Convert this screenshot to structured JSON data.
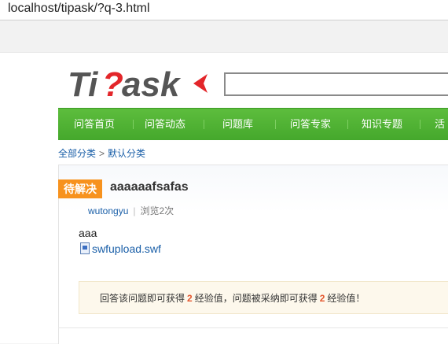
{
  "browser": {
    "url": "localhost/tipask/?q-3.html"
  },
  "logo": {
    "text": "Tipask"
  },
  "nav": {
    "items": [
      "问答首页",
      "问答动态",
      "问题库",
      "问答专家",
      "知识专题",
      "活"
    ]
  },
  "breadcrumb": {
    "root": "全部分类",
    "separator": ">",
    "current": "默认分类"
  },
  "question": {
    "status": "待解决",
    "title": "aaaaaafsafas",
    "author": "wutongyu",
    "views_label": "浏览2次",
    "body": "aaa",
    "attachment": "swfupload.swf"
  },
  "notice": {
    "part1": "回答该问题即可获得",
    "reward1": "2",
    "part2": "经验值，问题被采纳即可获得",
    "reward2": "2",
    "part3": "经验值！"
  },
  "colors": {
    "nav_green": "#4db332",
    "badge_orange": "#f7921e",
    "link_blue": "#1a5fa8",
    "logo_red": "#e3262a",
    "logo_gray": "#555555"
  }
}
